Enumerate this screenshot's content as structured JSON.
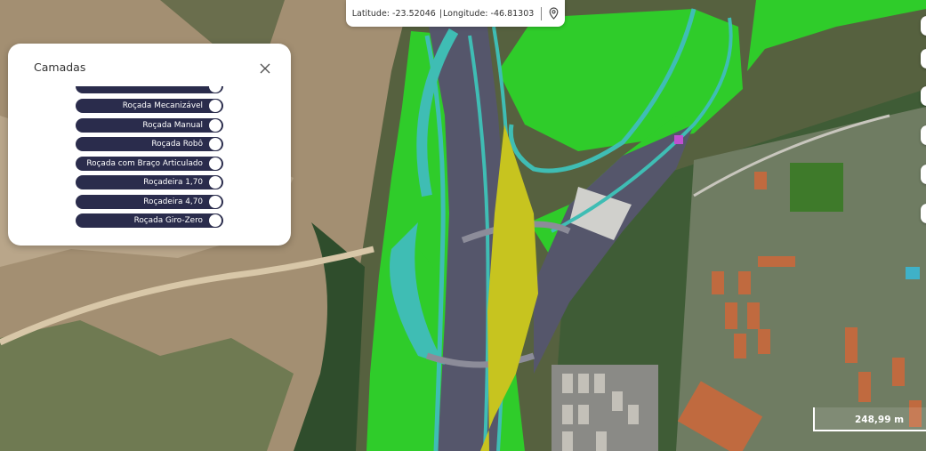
{
  "coordinates": {
    "latitude_label": "Latitude:",
    "latitude_value": "-23.52046",
    "separator": "|",
    "longitude_label": "Longitude:",
    "longitude_value": "-46.81303"
  },
  "layers_panel": {
    "title": "Camadas",
    "items": [
      {
        "label": ""
      },
      {
        "label": "Roçada Mecanizável"
      },
      {
        "label": "Roçada Manual"
      },
      {
        "label": "Roçada Robô"
      },
      {
        "label": "Roçada com Braço Articulado"
      },
      {
        "label": "Roçadeira 1,70"
      },
      {
        "label": "Roçadeira 4,70"
      },
      {
        "label": "Roçada Giro-Zero"
      }
    ]
  },
  "scale_bar": {
    "label": "248,99 m"
  },
  "icons": {
    "close": "close-icon",
    "location": "map-pin-icon"
  },
  "overlay_colors": {
    "bright_green": "#2fcc2a",
    "teal_road": "#3fbdb4",
    "yellow_median": "#c7c41f",
    "dark_pavement": "#55566b"
  }
}
